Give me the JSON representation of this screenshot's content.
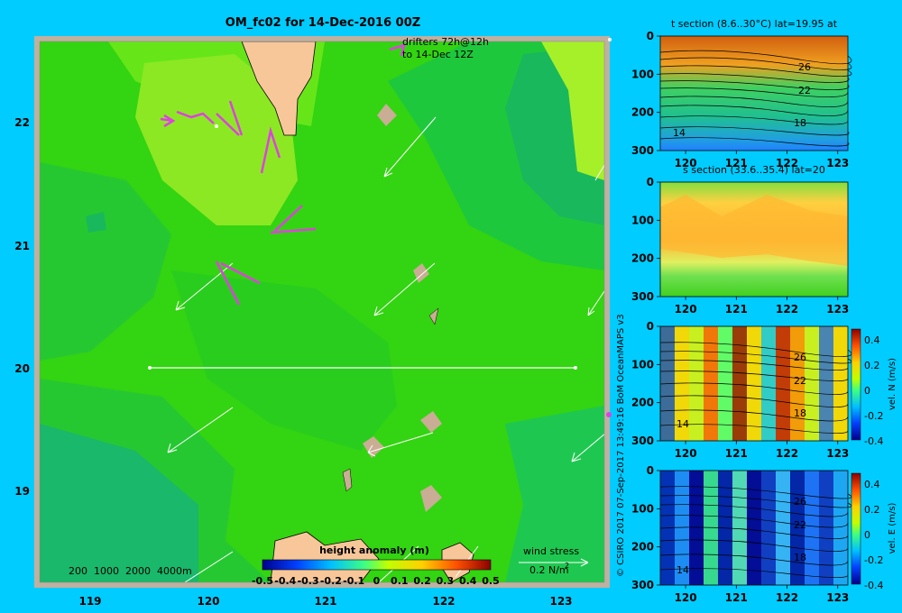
{
  "title": "OM_fc02 for 14-Dec-2016 00Z",
  "colors": {
    "background": "#00ccff",
    "land": "#f7c79a",
    "land_edge": "#c9ad94"
  },
  "map": {
    "x_ticks": [
      "119",
      "120",
      "121",
      "122",
      "123"
    ],
    "y_ticks": [
      "22",
      "21",
      "20",
      "19"
    ],
    "drifters_label_1": "drifters 72h@12h",
    "drifters_label_2": "to 14-Dec 12Z",
    "depth_legend": "200  1000  2000  4000m",
    "wind_label": "wind stress",
    "wind_scale": "0.2 N/m",
    "wind_scale_exp": "2",
    "colorbar_title": "height anomaly (m)",
    "colorbar_ticks": [
      "-0.5",
      "-0.4",
      "-0.3",
      "-0.2",
      "-0.1",
      "0",
      "0.1",
      "0.2",
      "0.3",
      "0.4",
      "0.5"
    ],
    "credit": "© CSIRO 2017   07-Sep-2017 13:49:16 BoM OceanMAPS v3"
  },
  "panels": [
    {
      "title": "t section (8.6..30°C) lat=19.95 at",
      "contour_labels": [
        "26",
        "22",
        "18",
        "14"
      ]
    },
    {
      "title": "s section (33.6..35.4) lat=20",
      "contour_labels": []
    },
    {
      "title": "",
      "cbar_label": "vel. N (m/s)",
      "contour_labels": [
        "26",
        "22",
        "18",
        "14"
      ]
    },
    {
      "title": "",
      "cbar_label": "vel. E (m/s)",
      "contour_labels": [
        "26",
        "22",
        "18",
        "14"
      ]
    }
  ],
  "panel_x_ticks": [
    "120",
    "121",
    "122",
    "123"
  ],
  "panel_y_ticks": [
    "0",
    "100",
    "200",
    "300"
  ],
  "vel_cbar_ticks": [
    "0.4",
    "0.2",
    "0",
    "-0.2",
    "-0.4"
  ],
  "chart_data": [
    {
      "type": "heatmap",
      "title": "OM_fc02 for 14-Dec-2016 00Z",
      "xlabel": "",
      "ylabel": "",
      "xlim": [
        118.5,
        123.5
      ],
      "ylim": [
        18.25,
        22.7
      ],
      "colorbar": "height anomaly (m)",
      "crange": [
        -0.5,
        0.5
      ],
      "section_line": {
        "lat": 20.0,
        "lon_start": 119.5,
        "lon_end": 123.2
      }
    },
    {
      "type": "heatmap",
      "title": "t section (8.6..30°C) lat=19.95 at",
      "xlim": [
        119.5,
        123.2
      ],
      "ylim": [
        300,
        0
      ]
    },
    {
      "type": "heatmap",
      "title": "s section (33.6..35.4) lat=20",
      "xlim": [
        119.5,
        123.2
      ],
      "ylim": [
        300,
        0
      ]
    },
    {
      "type": "heatmap",
      "colorbar": "vel. N (m/s)",
      "crange": [
        -0.4,
        0.4
      ],
      "xlim": [
        119.5,
        123.2
      ],
      "ylim": [
        300,
        0
      ]
    },
    {
      "type": "heatmap",
      "colorbar": "vel. E (m/s)",
      "crange": [
        -0.4,
        0.4
      ],
      "xlim": [
        119.5,
        123.2
      ],
      "ylim": [
        300,
        0
      ]
    }
  ]
}
